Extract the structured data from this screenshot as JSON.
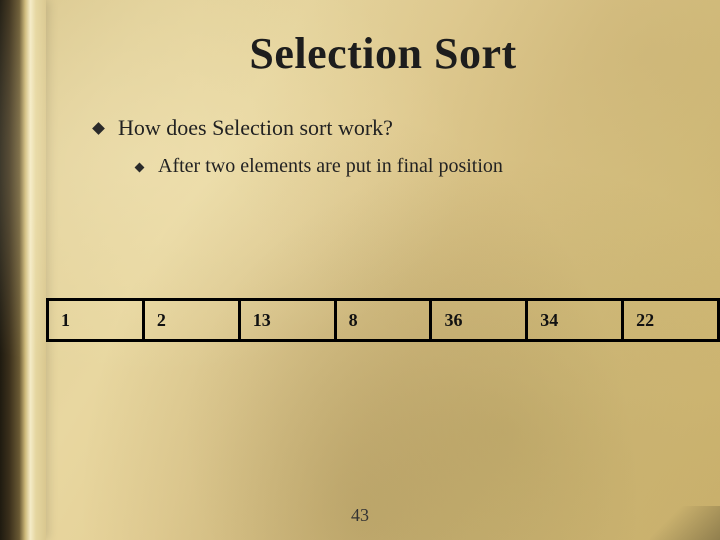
{
  "title": "Selection Sort",
  "bullets": {
    "level1": "How does Selection sort work?",
    "level2": "After two elements are put in final position"
  },
  "array": [
    "1",
    "2",
    "13",
    "8",
    "36",
    "34",
    "22"
  ],
  "page_number": "43"
}
